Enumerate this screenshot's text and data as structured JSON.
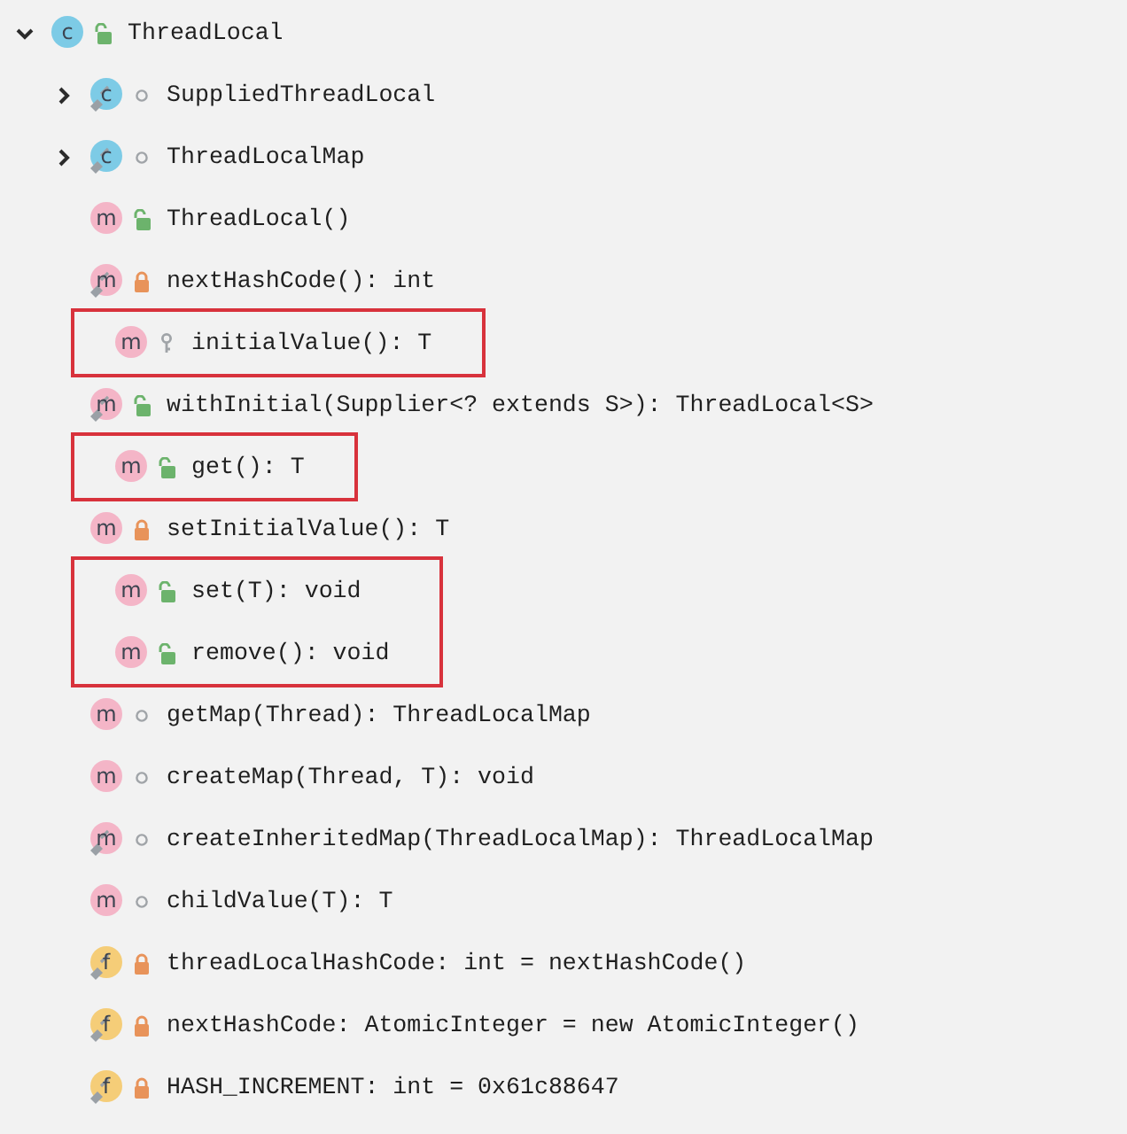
{
  "tree": {
    "label": "ThreadLocal",
    "kind": "class",
    "badge": "c",
    "access": {
      "kind": "public"
    },
    "static": false,
    "expanded": true,
    "highlighted": false,
    "children": [
      {
        "label": "SuppliedThreadLocal",
        "kind": "class",
        "badge": "c",
        "access": {
          "kind": "package"
        },
        "static": true,
        "expanded": false,
        "highlighted": false
      },
      {
        "label": "ThreadLocalMap",
        "kind": "class",
        "badge": "c",
        "access": {
          "kind": "package"
        },
        "static": true,
        "expanded": false,
        "highlighted": false
      },
      {
        "label": "ThreadLocal()",
        "kind": "method",
        "badge": "m",
        "access": {
          "kind": "public"
        },
        "static": false,
        "highlighted": false
      },
      {
        "label": "nextHashCode(): int",
        "kind": "method",
        "badge": "m",
        "access": {
          "kind": "private"
        },
        "static": true,
        "highlighted": false
      },
      {
        "label": "initialValue(): T",
        "kind": "method",
        "badge": "m",
        "access": {
          "kind": "protected"
        },
        "static": false,
        "highlighted": true
      },
      {
        "label": "withInitial(Supplier<? extends S>): ThreadLocal<S>",
        "kind": "method",
        "badge": "m",
        "access": {
          "kind": "public"
        },
        "static": true,
        "highlighted": false
      },
      {
        "label": "get(): T",
        "kind": "method",
        "badge": "m",
        "access": {
          "kind": "public"
        },
        "static": false,
        "highlighted": true
      },
      {
        "label": "setInitialValue(): T",
        "kind": "method",
        "badge": "m",
        "access": {
          "kind": "private"
        },
        "static": false,
        "highlighted": false
      },
      {
        "label": "set(T): void",
        "kind": "method",
        "badge": "m",
        "access": {
          "kind": "public"
        },
        "static": false,
        "highlighted": true
      },
      {
        "label": "remove(): void",
        "kind": "method",
        "badge": "m",
        "access": {
          "kind": "public"
        },
        "static": false,
        "highlighted": true
      },
      {
        "label": "getMap(Thread): ThreadLocalMap",
        "kind": "method",
        "badge": "m",
        "access": {
          "kind": "package"
        },
        "static": false,
        "highlighted": false
      },
      {
        "label": "createMap(Thread, T): void",
        "kind": "method",
        "badge": "m",
        "access": {
          "kind": "package"
        },
        "static": false,
        "highlighted": false
      },
      {
        "label": "createInheritedMap(ThreadLocalMap): ThreadLocalMap",
        "kind": "method",
        "badge": "m",
        "access": {
          "kind": "package"
        },
        "static": true,
        "highlighted": false
      },
      {
        "label": "childValue(T): T",
        "kind": "method",
        "badge": "m",
        "access": {
          "kind": "package"
        },
        "static": false,
        "highlighted": false
      },
      {
        "label": "threadLocalHashCode: int = nextHashCode()",
        "kind": "field",
        "badge": "f",
        "access": {
          "kind": "private"
        },
        "static": true,
        "highlighted": false
      },
      {
        "label": "nextHashCode: AtomicInteger = new AtomicInteger()",
        "kind": "field",
        "badge": "f",
        "access": {
          "kind": "private"
        },
        "static": true,
        "highlighted": false
      },
      {
        "label": "HASH_INCREMENT: int = 0x61c88647",
        "kind": "field",
        "badge": "f",
        "access": {
          "kind": "private"
        },
        "static": true,
        "highlighted": false
      }
    ]
  }
}
